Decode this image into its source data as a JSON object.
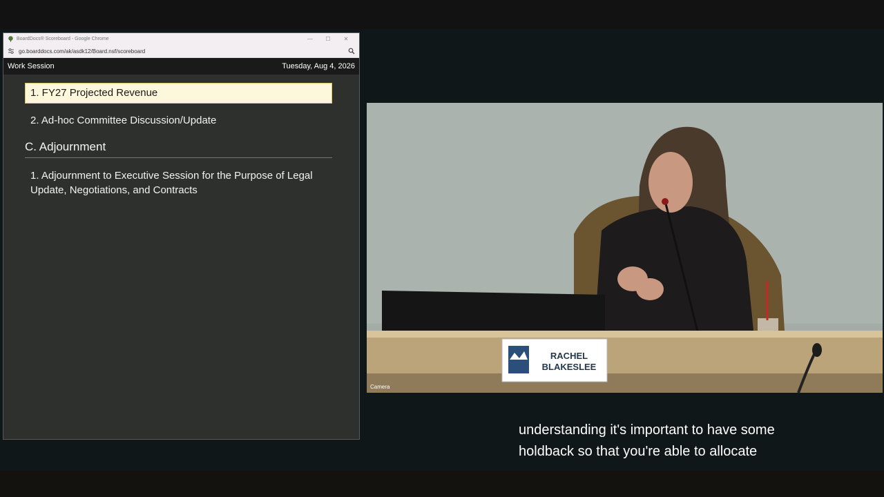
{
  "browser": {
    "tab_title": "BoardDocs® Scoreboard - Google Chrome",
    "url": "go.boarddocs.com/ak/asdk12/Board.nsf/scoreboard",
    "window_controls": {
      "minimize": "—",
      "maximize": "☐",
      "close": "✕"
    }
  },
  "page": {
    "session_title": "Work Session",
    "date": "Tuesday, Aug 4, 2026"
  },
  "agenda": {
    "items": [
      {
        "label": "1. FY27 Projected Revenue",
        "active": true
      },
      {
        "label": "2. Ad-hoc Committee Discussion/Update",
        "active": false
      }
    ],
    "section": "C. Adjournment",
    "section_items": [
      {
        "label": "1. Adjournment to Executive Session for the Purpose of Legal Update, Negotiations, and Contracts"
      }
    ]
  },
  "video": {
    "nameplate_line1": "RACHEL",
    "nameplate_line2": "BLAKESLEE",
    "camera_label": "Camera"
  },
  "caption": {
    "line1": "understanding it's important to have some",
    "line2": "holdback so that you're able to allocate"
  },
  "colors": {
    "active_item_bg": "#fdf8dc",
    "active_item_border": "#d8c96b",
    "page_bg": "#2e302e"
  }
}
